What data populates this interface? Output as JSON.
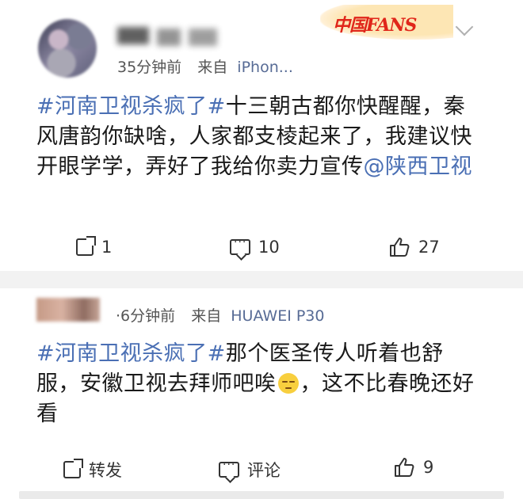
{
  "posts": [
    {
      "time": "35分钟前",
      "source_prefix": "来自",
      "source": "iPhon...",
      "badge": {
        "cn": "中国",
        "fans": "FANS"
      },
      "topic": "#河南卫视杀疯了#",
      "text_main": "十三朝古都你快醒醒，秦风唐韵你缺啥，人家都支棱起来了，我建议快开眼学学，弄好了我给你卖力宣传",
      "mention": "@陕西卫视",
      "actions": {
        "repost": "1",
        "comment": "10",
        "like": "27"
      }
    },
    {
      "time": "·6分钟前",
      "source_prefix": "来自",
      "source": "HUAWEI P30",
      "topic": "#河南卫视杀疯了#",
      "text_before_emoji": "那个医圣传人听着也舒服，安徽卫视去拜师吧唉",
      "emoji_name": "sad-face-icon",
      "text_after_emoji": "，这不比春晚还好看",
      "actions": {
        "repost": "转发",
        "comment": "评论",
        "like": "9"
      }
    }
  ],
  "colors": {
    "topic": "#4a6fb4",
    "badge_red": "#e0261a"
  }
}
